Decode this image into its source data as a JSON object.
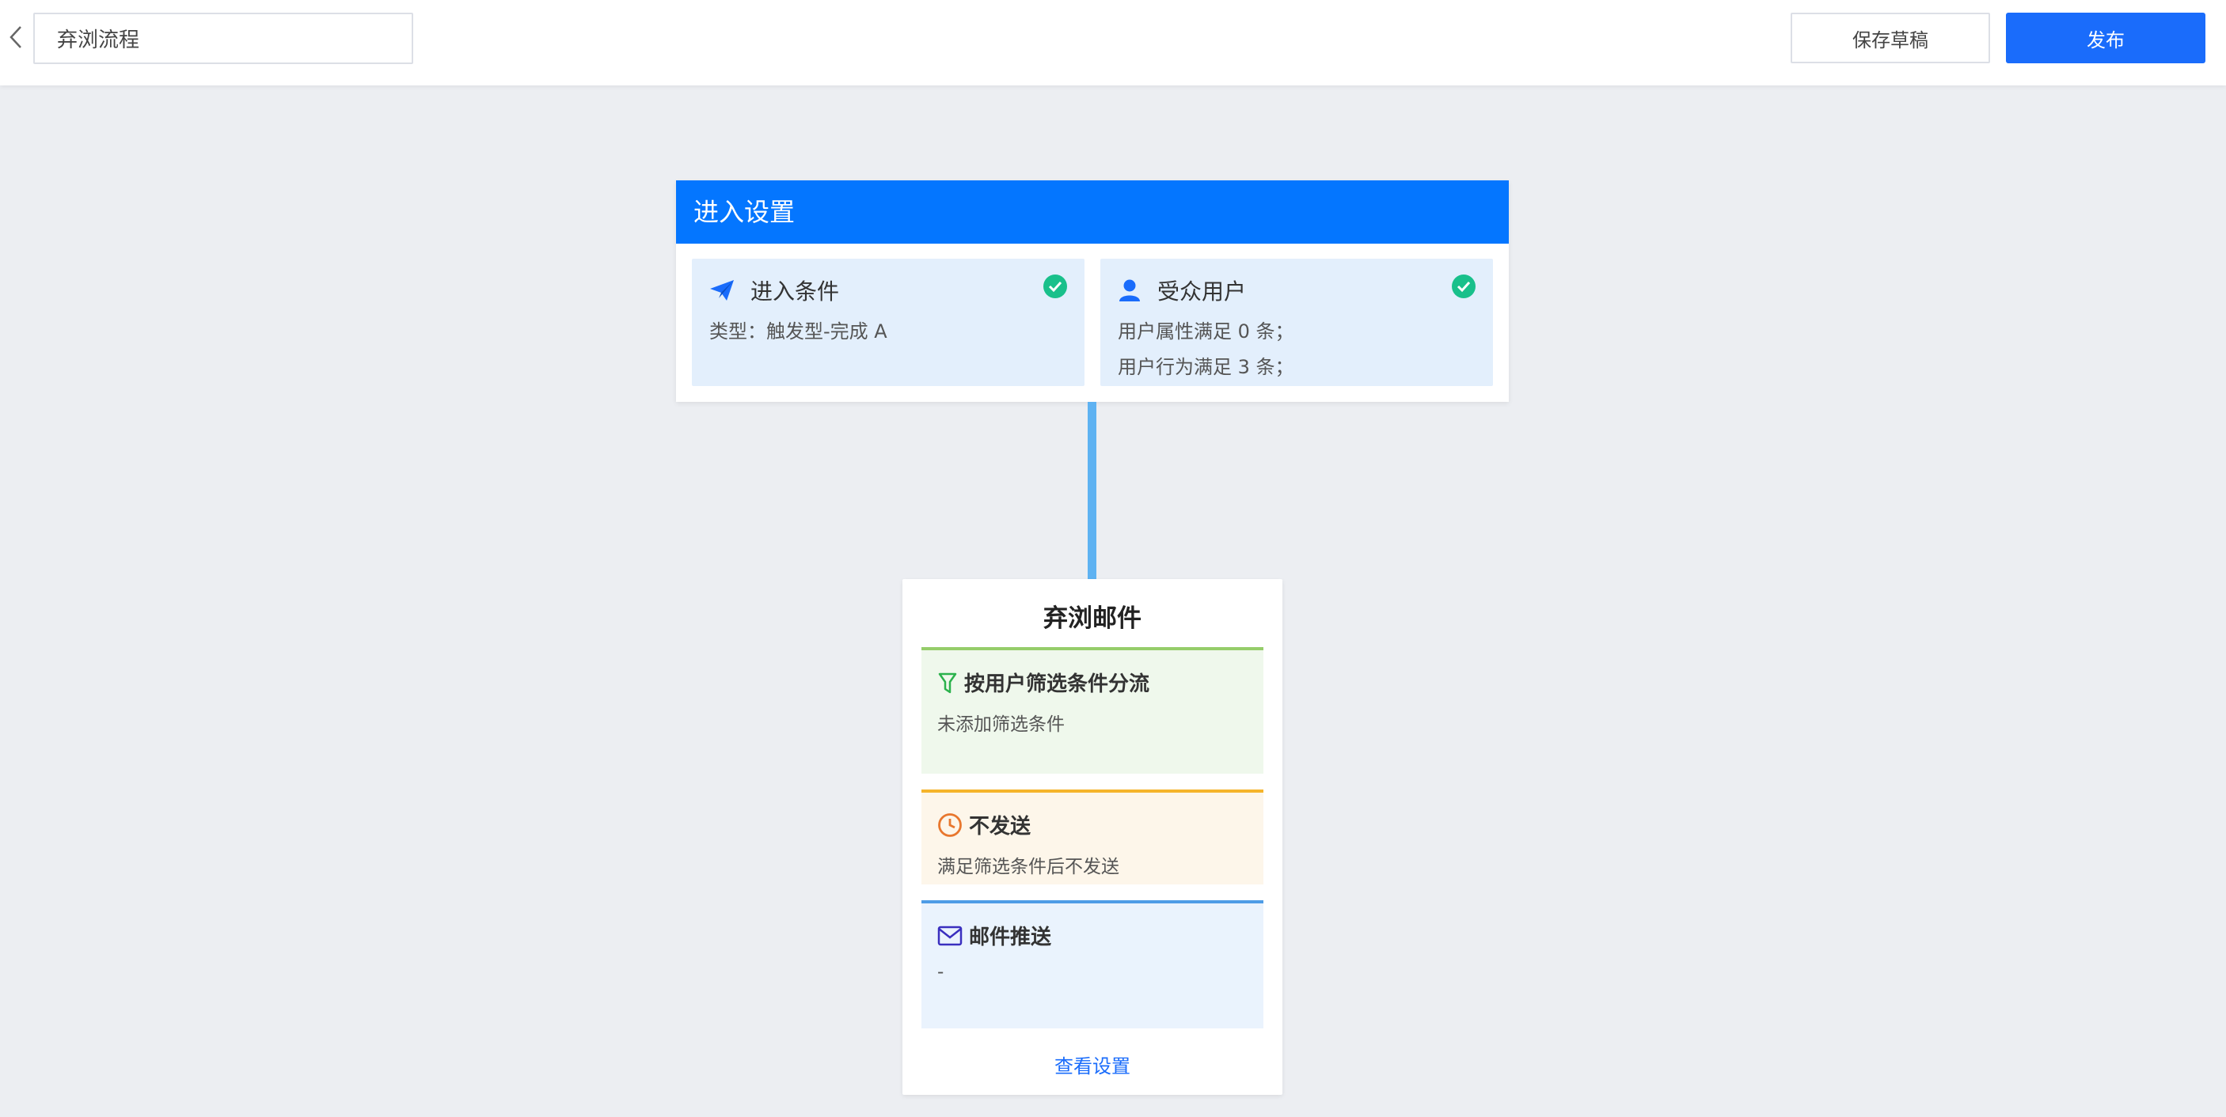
{
  "topbar": {
    "back_icon": "chevron-left-icon",
    "flow_name": "弃浏流程",
    "save_draft_label": "保存草稿",
    "publish_label": "发布",
    "publish_color": "#1a6cfb"
  },
  "entry": {
    "title": "进入设置",
    "header_color": "#0476ff",
    "condition": {
      "icon": "paper-plane-icon",
      "title": "进入条件",
      "status_icon": "check-circle-icon",
      "lines": [
        "类型：触发型-完成 A"
      ]
    },
    "audience": {
      "icon": "user-icon",
      "title": "受众用户",
      "status_icon": "check-circle-icon",
      "lines": [
        "用户属性满足 0 条；",
        "用户行为满足 3 条；"
      ]
    }
  },
  "email_node": {
    "title": "弃浏邮件",
    "steps": [
      {
        "icon": "filter-icon",
        "title": "按用户筛选条件分流",
        "desc": "未添加筛选条件",
        "accent": "#95cd6a"
      },
      {
        "icon": "clock-icon",
        "title": "不发送",
        "desc": "满足筛选条件后不发送",
        "accent": "#f5b42b"
      },
      {
        "icon": "mail-icon",
        "title": "邮件推送",
        "desc": "-",
        "accent": "#4e9ce6"
      }
    ],
    "view_settings_label": "查看设置"
  }
}
